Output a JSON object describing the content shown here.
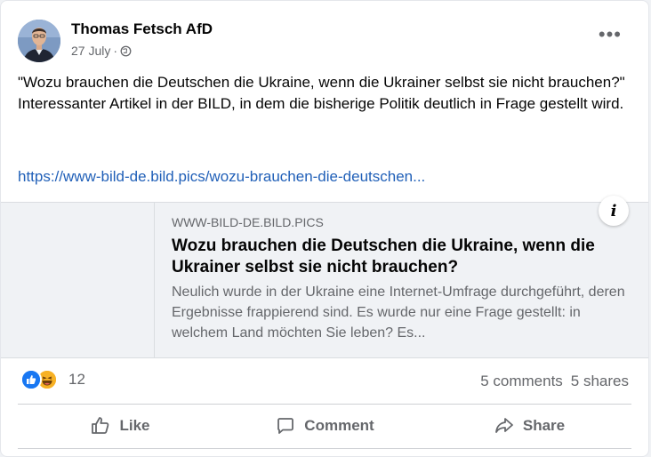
{
  "post": {
    "author": "Thomas Fetsch AfD",
    "date": "27 July",
    "separator": "·",
    "privacy_icon": "globe-icon",
    "more_label": "•••",
    "text_line1": "\"Wozu brauchen die Deutschen die Ukraine, wenn die Ukrainer selbst sie nicht brauchen?\"",
    "text_line2": "Interessanter Artikel in der BILD, in dem die bisherige Politik deutlich in Frage gestellt wird.",
    "link": "https://www-bild-de.bild.pics/wozu-brauchen-die-deutschen..."
  },
  "preview": {
    "domain": "WWW-BILD-DE.BILD.PICS",
    "title": "Wozu brauchen die Deutschen die Ukraine, wenn die Ukrainer selbst sie nicht brauchen?",
    "description": "Neulich wurde in der Ukraine eine Internet-Umfrage durchgeführt, deren Ergebnisse frappierend sind. Es wurde nur eine Frage gestellt: in welchem Land möchten Sie leben? Es...",
    "info_label": "i"
  },
  "engagement": {
    "reaction_icons": [
      "like-icon",
      "haha-icon"
    ],
    "reaction_count": "12",
    "comments": "5 comments",
    "shares": "5 shares"
  },
  "actions": {
    "like": "Like",
    "comment": "Comment",
    "share": "Share"
  },
  "colors": {
    "link": "#2160b8",
    "like_blue": "#1877f2",
    "haha_yellow": "#f7b125",
    "secondary_text": "#65676b"
  }
}
